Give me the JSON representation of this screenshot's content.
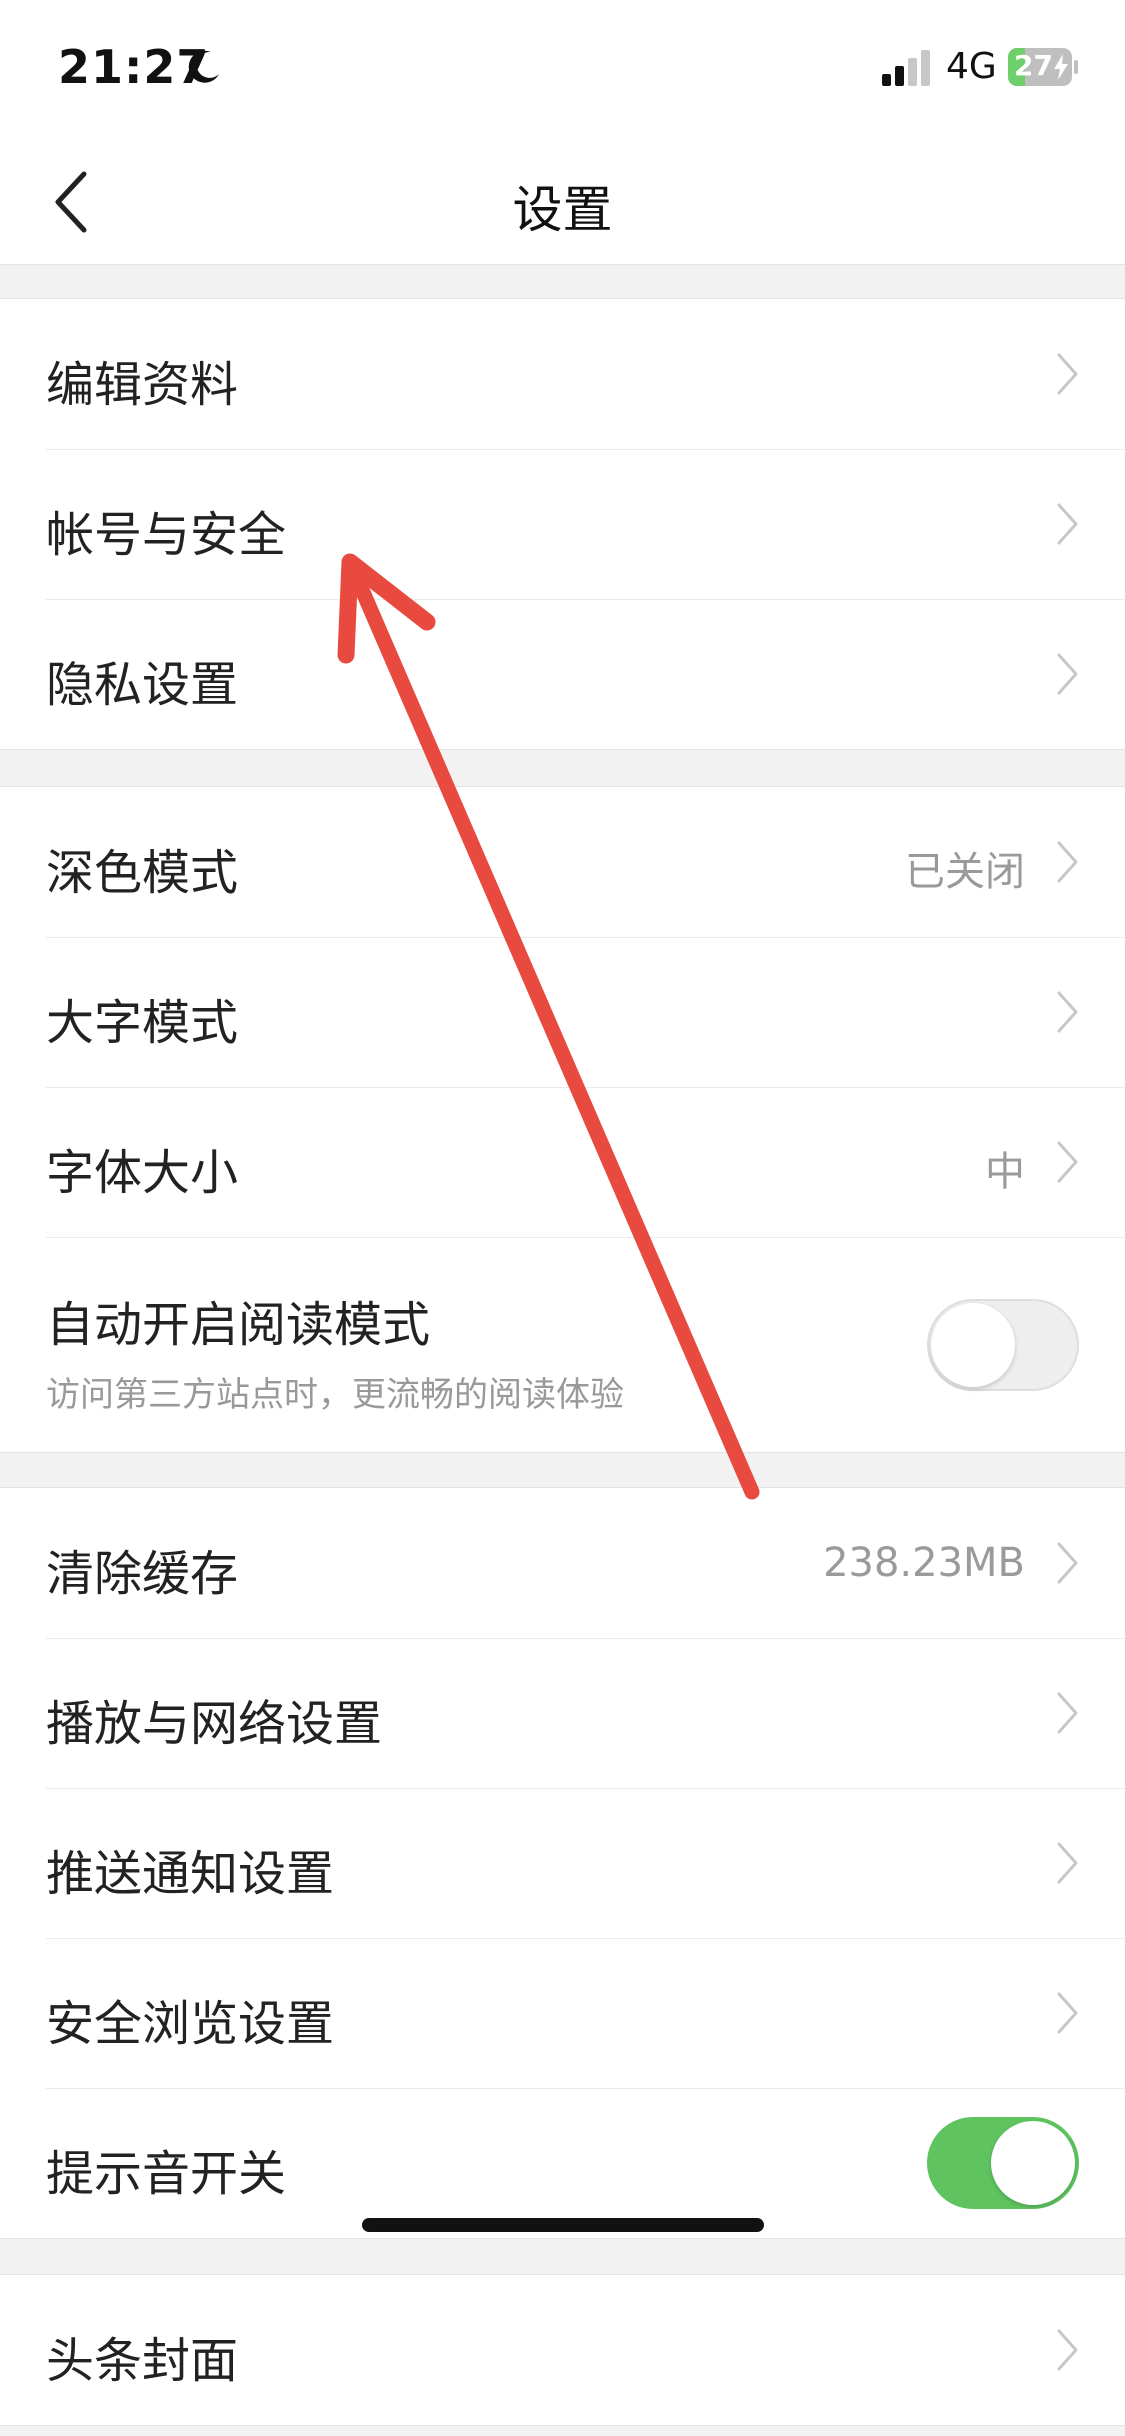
{
  "status_bar": {
    "time": "21:27",
    "network": "4G",
    "battery": "27",
    "battery_level_percent": 27,
    "moon_icon": "moon-icon",
    "signal_icon": "signal-bars-icon"
  },
  "nav": {
    "title": "设置",
    "back_icon": "chevron-left-icon"
  },
  "groups": {
    "account": [
      {
        "label": "编辑资料"
      },
      {
        "label": "帐号与安全"
      },
      {
        "label": "隐私设置"
      }
    ],
    "display": [
      {
        "label": "深色模式",
        "value": "已关闭"
      },
      {
        "label": "大字模式"
      },
      {
        "label": "字体大小",
        "value": "中"
      },
      {
        "label": "自动开启阅读模式",
        "subtitle": "访问第三方站点时，更流畅的阅读体验",
        "toggle": "off"
      }
    ],
    "general": [
      {
        "label": "清除缓存",
        "value": "238.23MB"
      },
      {
        "label": "播放与网络设置"
      },
      {
        "label": "推送通知设置"
      },
      {
        "label": "安全浏览设置"
      },
      {
        "label": "提示音开关",
        "toggle": "on"
      }
    ],
    "more": [
      {
        "label": "头条封面"
      }
    ]
  },
  "colors": {
    "toggle_on": "#5fc460",
    "toggle_off": "#eeeeee",
    "annotation_arrow": "#e84a3f",
    "battery_fill": "#6fcf6a"
  }
}
